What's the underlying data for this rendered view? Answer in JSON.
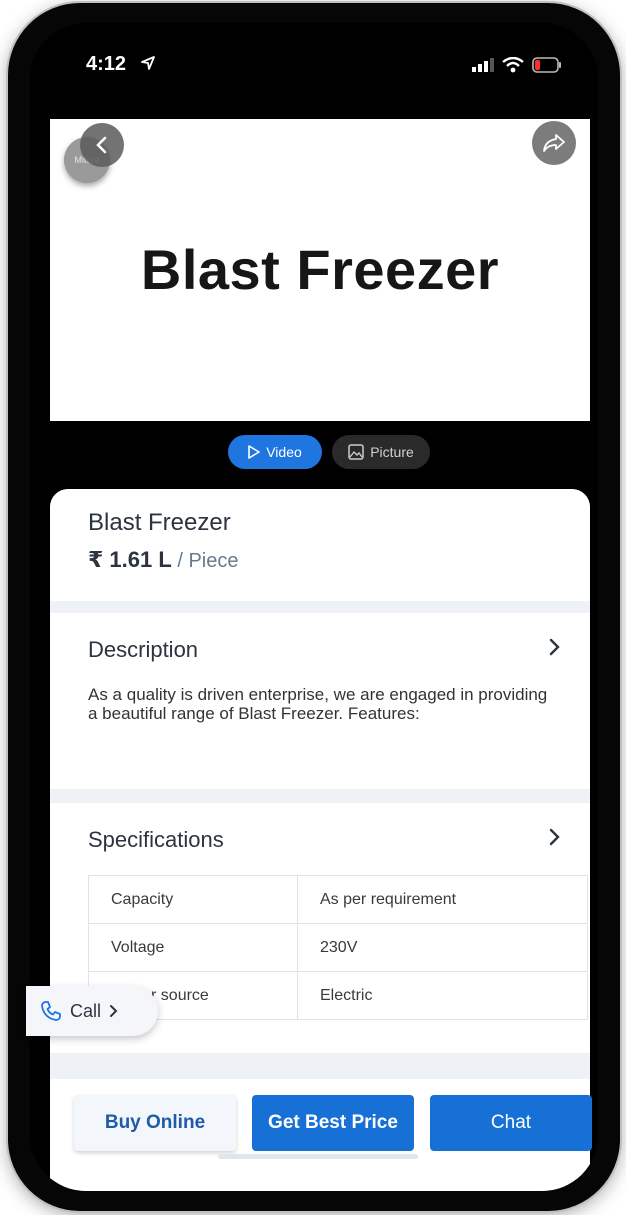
{
  "status_bar": {
    "time": "4:12"
  },
  "hero": {
    "title": "Blast Freezer",
    "logo_text": "Mitera"
  },
  "media_tabs": [
    {
      "label": "Video",
      "active": true
    },
    {
      "label": "Picture",
      "active": false
    }
  ],
  "product": {
    "title": "Blast Freezer",
    "price": "₹ 1.61 L",
    "unit": " / Piece"
  },
  "description": {
    "heading": "Description",
    "text": "As a quality is driven enterprise, we are engaged in providing a beautiful range of Blast Freezer. Features:"
  },
  "specifications": {
    "heading": "Specifications",
    "rows": [
      {
        "label": "Capacity",
        "value": "As per requirement"
      },
      {
        "label": "Voltage",
        "value": "230V"
      },
      {
        "label": "Power source",
        "value": "Electric"
      }
    ]
  },
  "call": {
    "label": "Call"
  },
  "actions": {
    "buy_online": "Buy Online",
    "best_price": "Get Best Price",
    "chat": "Chat"
  },
  "colors": {
    "accent": "#1670d6",
    "text": "#2c3440"
  }
}
